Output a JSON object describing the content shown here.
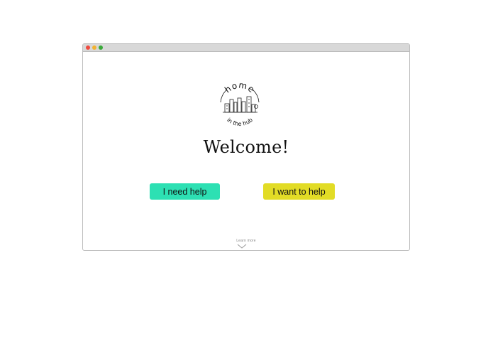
{
  "window": {
    "controls": [
      "close",
      "minimize",
      "maximize"
    ]
  },
  "logo": {
    "top_text": "home",
    "bottom_text": "in the hub"
  },
  "welcome": {
    "title": "Welcome!"
  },
  "actions": {
    "need_help_label": "I need help",
    "want_help_label": "I want to help"
  },
  "footer": {
    "learn_more_label": "Learn more",
    "chevron_icon": "chevron-down-icon"
  },
  "colors": {
    "need_help_bg": "#2de0b3",
    "want_help_bg": "#e2dc26",
    "close_dot": "#ef4a3f",
    "minimize_dot": "#f2b332",
    "maximize_dot": "#3aa93a"
  }
}
